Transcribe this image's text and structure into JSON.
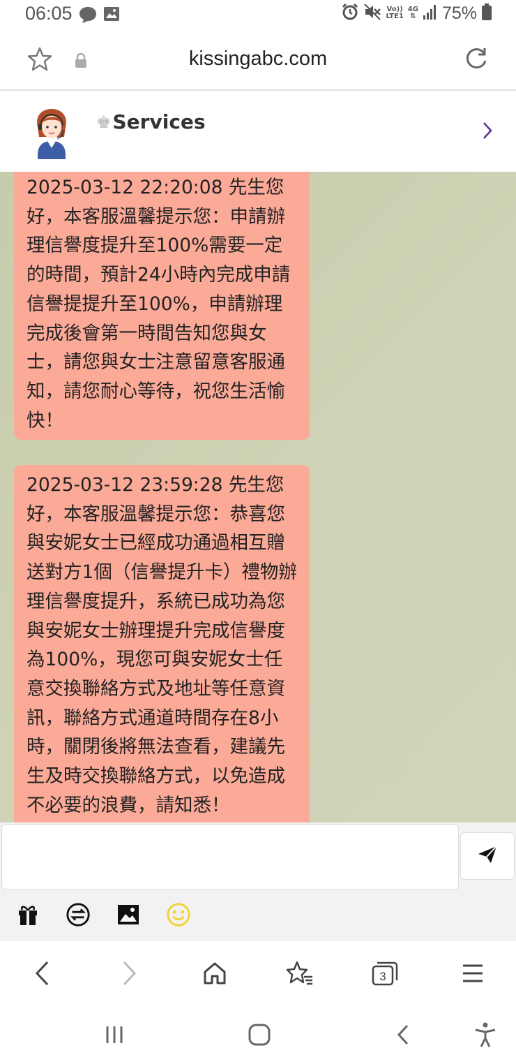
{
  "status_bar": {
    "time": "06:05",
    "network_top": "Vo))",
    "network_bottom": "LTE1",
    "net_type": "4G",
    "battery": "75%"
  },
  "browser": {
    "url": "kissingabc.com",
    "tab_count": "3"
  },
  "chat": {
    "title": "Services",
    "messages": [
      {
        "sender": "service",
        "text": "2025-03-12 22:20:08 先生您好，本客服溫馨提示您：申請辦理信譽度提升至100%需要一定的時間，預計24小時內完成申請信譽提提升至100%，申請辦理完成後會第一時間告知您與女士，請您與女士注意留意客服通知，請您耐心等待，祝您生活愉快！"
      },
      {
        "sender": "service",
        "text": "2025-03-12 23:59:28 先生您好，本客服溫馨提示您：恭喜您與安妮女士已經成功通過相互贈送對方1個（信譽提升卡）禮物辦理信譽度提升，系統已成功為您與安妮女士辦理提升完成信譽度為100%，現您可與安妮女士任意交換聯絡方式及地址等任意資訊，聯絡方式通道時間存在8小時，關閉後將無法查看，建議先生及時交換聯絡方式，以免造成不必要的浪費，請知悉！"
      }
    ],
    "input_value": ""
  },
  "icons": {
    "status": [
      "chat-bubble-icon",
      "image-icon",
      "alarm-icon",
      "mute-icon",
      "signal-icon",
      "battery-icon"
    ],
    "toolbar": [
      "gift-icon",
      "exchange-icon",
      "image-icon",
      "emoji-icon"
    ],
    "browser_nav": [
      "back-icon",
      "forward-icon",
      "home-icon",
      "bookmarks-icon",
      "tabs-icon",
      "menu-icon"
    ],
    "system_nav": [
      "recents-icon",
      "home-button-icon",
      "back-icon",
      "accessibility-icon"
    ]
  },
  "colors": {
    "bubble": "#fcaa98",
    "chat_background": "#cbcfb0",
    "accent_chevron": "#5b2d8e",
    "emoji": "#f2d230"
  }
}
